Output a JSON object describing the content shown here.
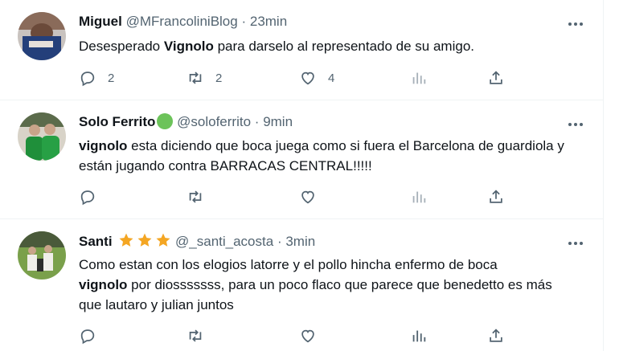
{
  "tweets": [
    {
      "name": "Miguel",
      "handle": "@MFrancoliniBlog",
      "time": "23min",
      "text_parts": [
        "Desesperado ",
        "Vignolo",
        " para darselo al representado de su amigo."
      ],
      "replies": "2",
      "retweets": "2",
      "likes": "4",
      "avatar_colors": [
        "#5a3b2e",
        "#c9c3bf",
        "#243f7a"
      ]
    },
    {
      "name": "Solo Ferrito",
      "handle": "@soloferrito",
      "time": "9min",
      "text_parts": [
        "vignolo",
        " esta diciendo que boca juega como si fuera el Barcelona de guardiola y están jugando contra BARRACAS CENTRAL!!!!!"
      ],
      "replies": "",
      "retweets": "",
      "likes": "",
      "badge_color": "#6cc35a",
      "avatar_colors": [
        "#3a6b35",
        "#1f8f3a",
        "#d8d3c8"
      ]
    },
    {
      "name": "Santi",
      "handle": "@_santi_acosta",
      "time": "3min",
      "text_parts": [
        "Como estan con los elogios latorre y el pollo hincha enfermo de boca ",
        "vignolo",
        " por diosssssss, para un poco flaco que parece que benedetto es más que lautaro y julian juntos"
      ],
      "replies": "",
      "retweets": "",
      "likes": "",
      "star_color": "#f4a623",
      "avatar_colors": [
        "#5f8f3c",
        "#e9e6e1",
        "#2c2c2c"
      ]
    }
  ],
  "separator": "·"
}
